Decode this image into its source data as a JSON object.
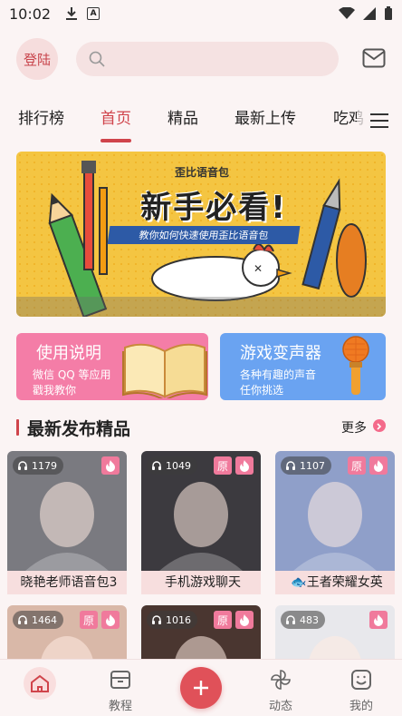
{
  "status_bar": {
    "time": "10:02"
  },
  "header": {
    "login_label": "登陆",
    "search_placeholder": ""
  },
  "tabs": [
    "排行榜",
    "首页",
    "精品",
    "最新上传",
    "吃鸡"
  ],
  "active_tab": "首页",
  "banner": {
    "subtitle": "歪比语音包",
    "title": "新手必看!",
    "strip": "教你如何快速使用歪比语音包"
  },
  "cards": [
    {
      "title": "使用说明",
      "desc": [
        "微信 QQ 等应用",
        "戳我教你"
      ],
      "icon": "book-icon"
    },
    {
      "title": "游戏变声器",
      "desc": [
        "各种有趣的声音",
        "任你挑选"
      ],
      "icon": "microphone-icon"
    }
  ],
  "section": {
    "title": "最新发布精品",
    "more": "更多"
  },
  "items": [
    {
      "count": "1179",
      "caption": "晓艳老师语音包3",
      "original": false,
      "hot": true,
      "bg": "#7a7a80"
    },
    {
      "count": "1049",
      "caption": "手机游戏聊天",
      "original": true,
      "original_label": "原",
      "hot": true,
      "bg": "#3c3a3f"
    },
    {
      "count": "1107",
      "caption": "🐟王者荣耀女英",
      "original": true,
      "original_label": "原",
      "hot": true,
      "bg": "#8f9fc9"
    },
    {
      "count": "1464",
      "caption": "",
      "original": true,
      "original_label": "原",
      "hot": true,
      "bg": "#d9b8a8"
    },
    {
      "count": "1016",
      "caption": "",
      "original": true,
      "original_label": "原",
      "hot": true,
      "bg": "#4a3630"
    },
    {
      "count": "483",
      "caption": "",
      "original": false,
      "hot": true,
      "bg": "#e8e8ec"
    }
  ],
  "bottom_nav": [
    {
      "label": "",
      "icon": "home-icon",
      "active": true
    },
    {
      "label": "教程",
      "icon": "box-icon"
    },
    {
      "label": "",
      "icon": "plus-icon"
    },
    {
      "label": "动态",
      "icon": "pinwheel-icon"
    },
    {
      "label": "我的",
      "icon": "smiley-icon"
    }
  ],
  "colors": {
    "accent": "#d0444b",
    "pink_card": "#f47da7",
    "blue_card": "#6aa3f1",
    "banner": "#f4c542"
  }
}
